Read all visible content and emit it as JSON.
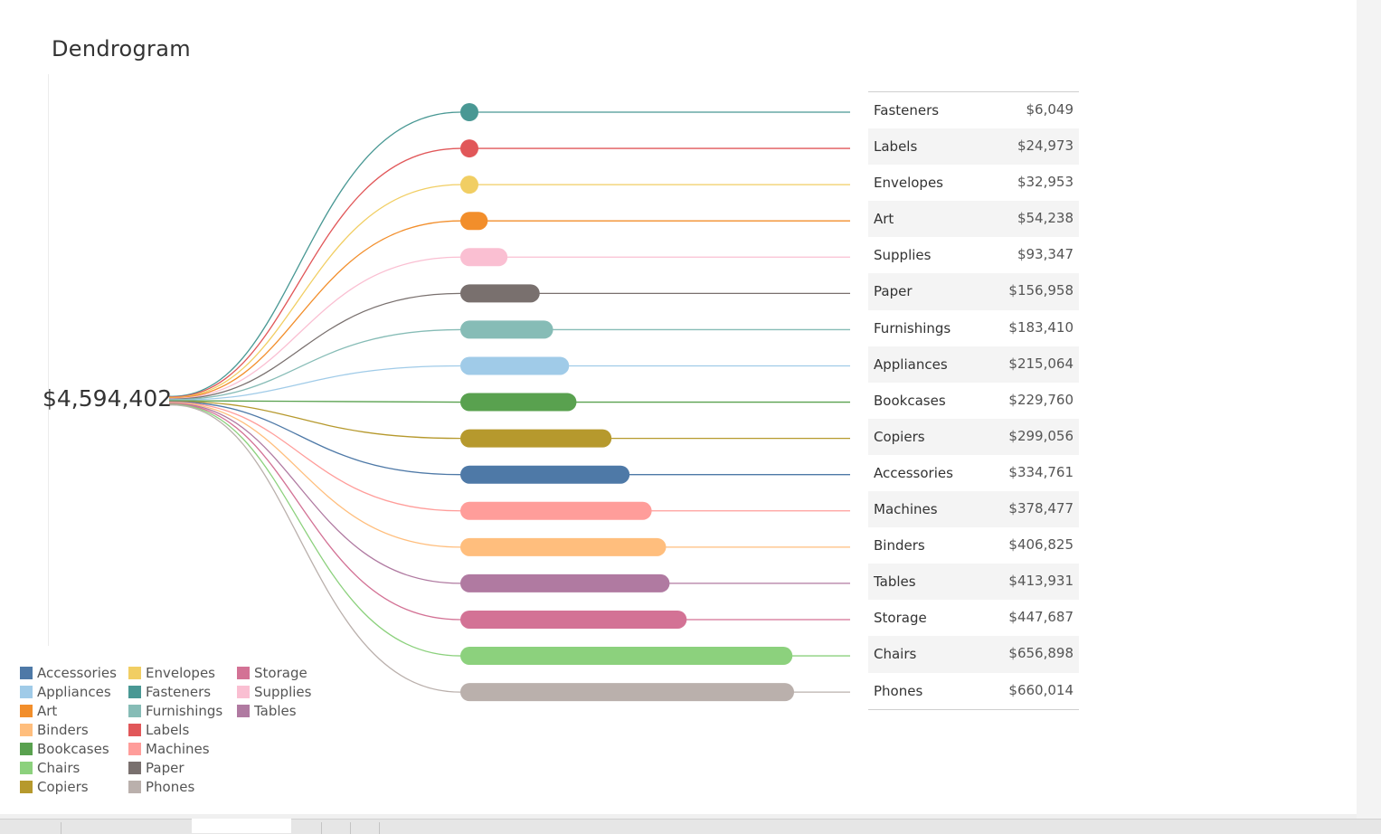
{
  "title": "Dendrogram",
  "total_label": "$4,594,402",
  "colors": {
    "Accessories": "#4e79a7",
    "Appliances": "#a0cbe8",
    "Art": "#f28e2b",
    "Binders": "#ffbe7d",
    "Bookcases": "#59a14f",
    "Chairs": "#8cd17d",
    "Copiers": "#b6992d",
    "Envelopes": "#f1ce63",
    "Fasteners": "#499894",
    "Furnishings": "#86bcb6",
    "Labels": "#e15759",
    "Machines": "#ff9d9a",
    "Paper": "#79706e",
    "Phones": "#bab0ac",
    "Storage": "#d37295",
    "Supplies": "#fabfd2",
    "Tables": "#b07aa1"
  },
  "chart_data": {
    "type": "bar",
    "orientation": "horizontal",
    "title": "Dendrogram",
    "total": 4594402,
    "categories": [
      "Fasteners",
      "Labels",
      "Envelopes",
      "Art",
      "Supplies",
      "Paper",
      "Furnishings",
      "Appliances",
      "Bookcases",
      "Copiers",
      "Accessories",
      "Machines",
      "Binders",
      "Tables",
      "Storage",
      "Chairs",
      "Phones"
    ],
    "values": [
      6049,
      24973,
      32953,
      54238,
      93347,
      156958,
      183410,
      215064,
      229760,
      299056,
      334761,
      378477,
      406825,
      413931,
      447687,
      656898,
      660014
    ],
    "value_labels": [
      "$6,049",
      "$24,973",
      "$32,953",
      "$54,238",
      "$93,347",
      "$156,958",
      "$183,410",
      "$215,064",
      "$229,760",
      "$299,056",
      "$334,761",
      "$378,477",
      "$406,825",
      "$413,931",
      "$447,687",
      "$656,898",
      "$660,014"
    ],
    "legend": {
      "columns": [
        [
          "Accessories",
          "Appliances",
          "Art",
          "Binders",
          "Bookcases",
          "Chairs",
          "Copiers"
        ],
        [
          "Envelopes",
          "Fasteners",
          "Furnishings",
          "Labels",
          "Machines",
          "Paper",
          "Phones"
        ],
        [
          "Storage",
          "Supplies",
          "Tables"
        ]
      ],
      "position": "bottom-left"
    }
  }
}
